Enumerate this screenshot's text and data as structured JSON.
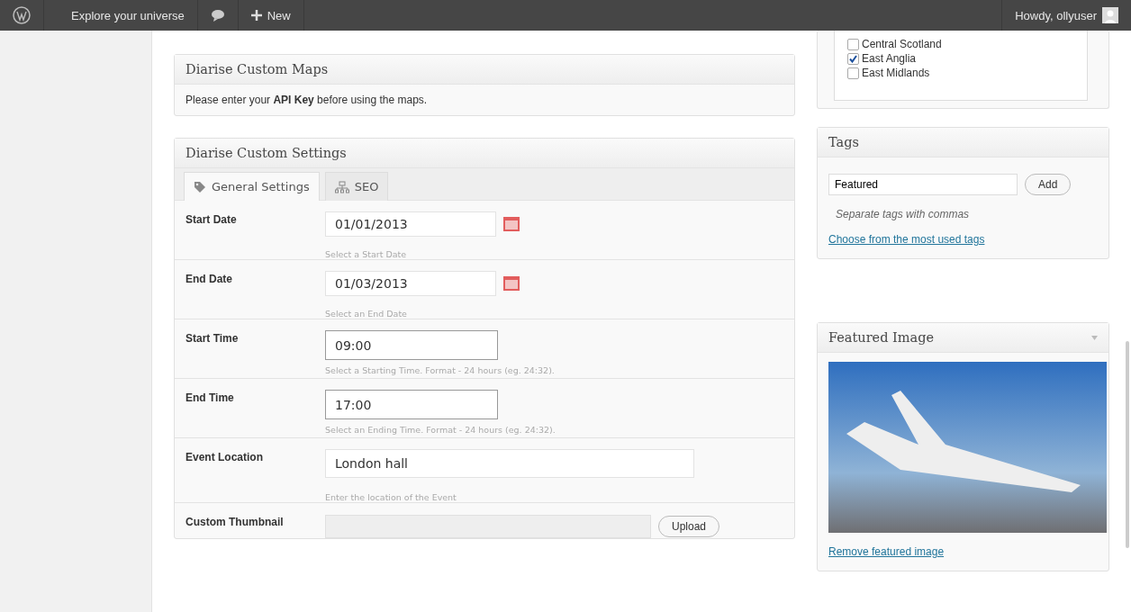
{
  "admin_bar": {
    "site_name": "Explore your universe",
    "new_label": "New",
    "greeting": "Howdy, ollyuser"
  },
  "maps_box": {
    "title": "Diarise Custom Maps",
    "message": "Please enter your **API Key** before using the maps."
  },
  "settings_box": {
    "title": "Diarise Custom Settings",
    "tabs": [
      {
        "label": "General Settings",
        "selected": true,
        "kind": "tag"
      },
      {
        "label": "SEO",
        "selected": false,
        "kind": "sitemap"
      }
    ],
    "fields": [
      {
        "label": "Start Date",
        "value": "01/01/2013",
        "hint": "Select a Start Date",
        "kind": "date"
      },
      {
        "label": "End Date",
        "value": "01/03/2013",
        "hint": "Select an End Date",
        "kind": "date"
      },
      {
        "label": "Start Time",
        "value": "09:00",
        "hint": "Select a Starting Time. Format - 24 hours (eg. 24:32).",
        "kind": "time"
      },
      {
        "label": "End Time",
        "value": "17:00",
        "hint": "Select an Ending Time. Format - 24 hours (eg. 24:32).",
        "kind": "time"
      },
      {
        "label": "Event Location",
        "value": "London hall",
        "hint": "Enter the location of the Event",
        "kind": "text"
      },
      {
        "label": "Custom Thumbnail",
        "button": "Upload",
        "kind": "upload"
      }
    ]
  },
  "regions": [
    {
      "label": "Central Scotland",
      "checked": false
    },
    {
      "label": "East Anglia",
      "checked": true
    },
    {
      "label": "East Midlands",
      "checked": false
    }
  ],
  "tags_box": {
    "title": "Tags",
    "value": "Featured",
    "add_button": "Add",
    "hint": "Separate tags with commas",
    "link": "Choose from the most used tags"
  },
  "featured_image_box": {
    "title": "Featured Image",
    "remove_link": "Remove featured image"
  }
}
